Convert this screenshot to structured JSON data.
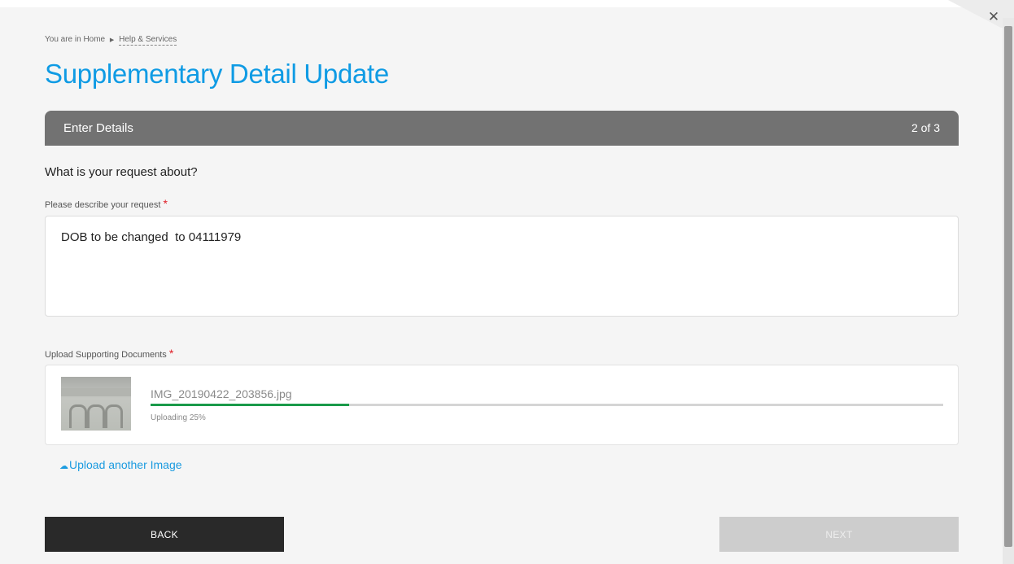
{
  "breadcrumb": {
    "prefix": "You are in Home",
    "current": "Help & Services"
  },
  "page_title": "Supplementary Detail Update",
  "stepbar": {
    "title": "Enter Details",
    "step": "2 of 3"
  },
  "question": "What is your request about?",
  "request": {
    "label": "Please describe your request",
    "required_mark": "*",
    "value": "DOB to be changed  to 04111979"
  },
  "upload": {
    "label": "Upload Supporting Documents",
    "required_mark": "*",
    "file_name": "IMG_20190422_203856.jpg",
    "progress_percent": 25,
    "status": "Uploading 25%",
    "another_label": "Upload another Image"
  },
  "buttons": {
    "back": "BACK",
    "next": "NEXT"
  },
  "icons": {
    "close": "close-icon",
    "upload": "cloud-upload-icon",
    "breadcrumb_separator": "triangle-right-icon"
  },
  "colors": {
    "title_blue": "#0f9be4",
    "link_blue": "#1b9be0",
    "stepbar": "#727272",
    "progress_green": "#1a9a4a",
    "required_red": "#e01e26",
    "back_button": "#292929",
    "next_button_disabled": "#cdcdcd"
  }
}
